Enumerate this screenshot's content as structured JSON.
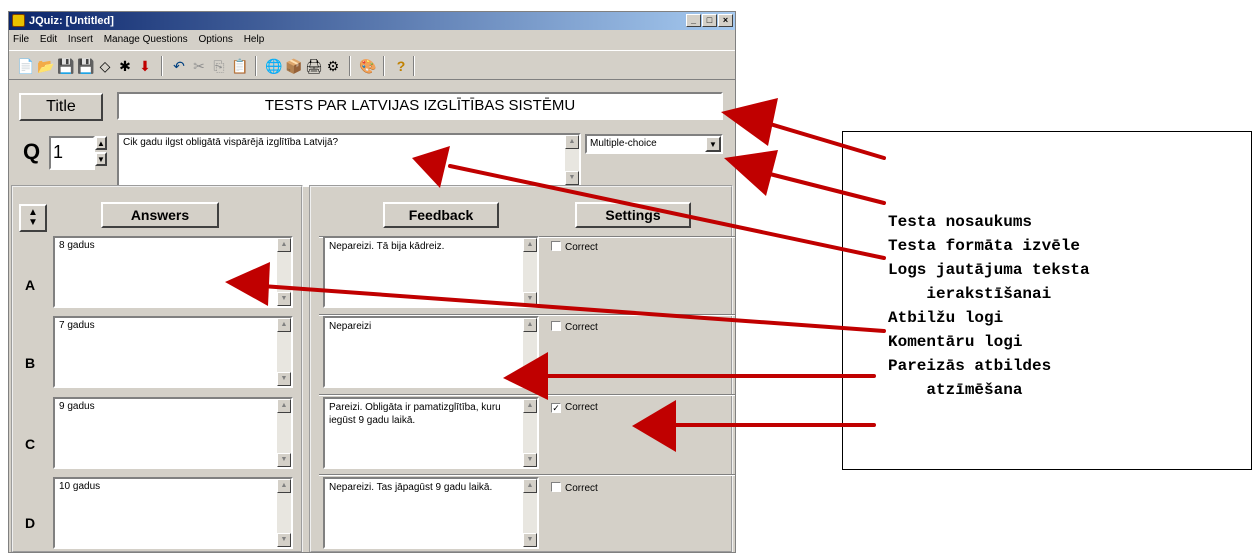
{
  "window": {
    "title": "JQuiz: [Untitled]",
    "min": "_",
    "max": "□",
    "close": "×"
  },
  "menu": [
    "File",
    "Edit",
    "Insert",
    "Manage Questions",
    "Options",
    "Help"
  ],
  "editor": {
    "title_button": "Title",
    "title_value": "TESTS PAR LATVIJAS IZGLĪTĪBAS SISTĒMU",
    "q_letter": "Q",
    "q_number": "1",
    "question_text": "Cik gadu ilgst obligātā vispārējā izglītība Latvijā?",
    "question_type": "Multiple-choice",
    "answers_header": "Answers",
    "feedback_header": "Feedback",
    "settings_header": "Settings"
  },
  "answers": [
    {
      "letter": "A",
      "answer": "8 gadus",
      "feedback": "Nepareizi. Tā bija kādreiz.",
      "correct_label": "Correct",
      "correct": false,
      "check": ""
    },
    {
      "letter": "B",
      "answer": "7 gadus",
      "feedback": "Nepareizi",
      "correct_label": "Correct",
      "correct": false,
      "check": ""
    },
    {
      "letter": "C",
      "answer": "9 gadus",
      "feedback": "Pareizi. Obligāta ir pamatizglītība, kuru iegūst 9 gadu laikā.",
      "correct_label": "Correct",
      "correct": true,
      "check": "✓"
    },
    {
      "letter": "D",
      "answer": "10 gadus",
      "feedback": "Nepareizi. Tas jāpagūst 9 gadu laikā.",
      "correct_label": "Correct",
      "correct": false,
      "check": ""
    }
  ],
  "annotations": [
    "Testa nosaukums",
    "Testa formāta izvēle",
    "Logs jautājuma teksta",
    "    ierakstīšanai",
    "Atbilžu logi",
    "Komentāru logi",
    "Pareizās atbildes",
    "    atzīmēšana"
  ],
  "colors": {
    "arrow": "#c00000",
    "titlebar": "#0a246a"
  },
  "toolbar_icons": [
    "new-icon",
    "open-icon",
    "save-icon",
    "save-as-icon",
    "clear-icon",
    "add-icon",
    "down-icon",
    "undo-icon",
    "cut-icon",
    "copy-icon",
    "paste-icon",
    "web-icon",
    "export-icon",
    "print-icon",
    "html-icon",
    "config-icon",
    "help-icon"
  ]
}
